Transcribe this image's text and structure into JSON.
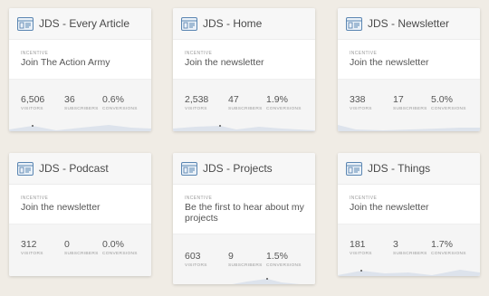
{
  "labels": {
    "incentive": "INCENTIVE",
    "visitors": "VISITORS",
    "subscribers": "SUBSCRIBERS",
    "conversions": "CONVERSIONS"
  },
  "colors": {
    "background": "#f0ece5",
    "icon": "#5b86b2",
    "sparkline": "#dde3ec"
  },
  "cards": [
    {
      "title": "JDS - Every Article",
      "incentive": "Join The Action Army",
      "visitors": "6,506",
      "subscribers": "36",
      "conversions": "0.6%"
    },
    {
      "title": "JDS - Home",
      "incentive": "Join the newsletter",
      "visitors": "2,538",
      "subscribers": "47",
      "conversions": "1.9%"
    },
    {
      "title": "JDS - Newsletter",
      "incentive": "Join the newsletter",
      "visitors": "338",
      "subscribers": "17",
      "conversions": "5.0%"
    },
    {
      "title": "JDS - Podcast",
      "incentive": "Join the newsletter",
      "visitors": "312",
      "subscribers": "0",
      "conversions": "0.0%"
    },
    {
      "title": "JDS - Projects",
      "incentive": "Be the first to hear about my projects",
      "visitors": "603",
      "subscribers": "9",
      "conversions": "1.5%"
    },
    {
      "title": "JDS - Things",
      "incentive": "Join the newsletter",
      "visitors": "181",
      "subscribers": "3",
      "conversions": "1.7%"
    }
  ]
}
